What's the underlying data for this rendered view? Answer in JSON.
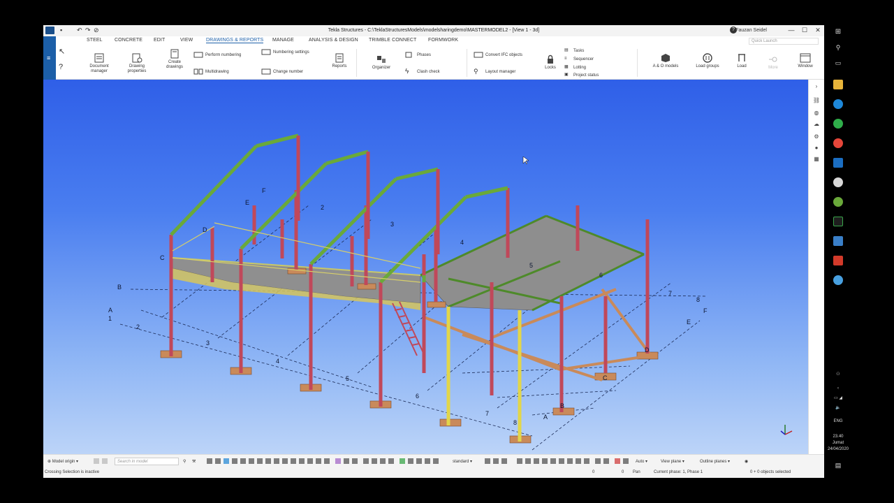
{
  "window": {
    "title": "Tekla Structures - C:\\TeklaStructuresModels\\modelsharingdemo\\MASTERMODEL2 - [View 1 - 3d]",
    "user": "Fauzan Seidel",
    "minimize": "—",
    "maximize": "☐",
    "close": "✕",
    "help": "?"
  },
  "tabs": [
    "STEEL",
    "CONCRETE",
    "EDIT",
    "VIEW",
    "DRAWINGS & REPORTS",
    "MANAGE",
    "ANALYSIS & DESIGN",
    "TRIMBLE CONNECT",
    "FORMWORK"
  ],
  "active_tab": "DRAWINGS & REPORTS",
  "quick_launch": "Quick Launch",
  "ribbon": {
    "document_manager": "Document manager",
    "drawing_properties": "Drawing properties",
    "create_drawings": "Create drawings",
    "perform_numbering": "Perform numbering",
    "numbering_settings": "Numbering settings",
    "multidrawing": "Multidrawing",
    "change_number": "Change number",
    "reports": "Reports",
    "organizer": "Organizer",
    "phases": "Phases",
    "clash_check": "Clash check",
    "convert_ifc": "Convert IFC objects",
    "layout_manager": "Layout manager",
    "locks": "Locks",
    "tasks": "Tasks",
    "sequencer": "Sequencer",
    "lotting": "Lotting",
    "project_status": "Project status",
    "ab_models": "A & O models",
    "load_groups": "Load groups",
    "load": "Load",
    "more": "More",
    "window": "Window"
  },
  "grid_labels": {
    "axis_numbers": [
      "1",
      "2",
      "3",
      "4",
      "5",
      "6",
      "7",
      "8"
    ],
    "axis_letters": [
      "A",
      "B",
      "C",
      "D",
      "E",
      "F"
    ],
    "floor_labels": [
      "5",
      "6"
    ]
  },
  "bottombar": {
    "model_origin": "Model origin",
    "search_placeholder": "Search in model",
    "standard": "standard",
    "auto": "Auto",
    "view_plane": "View plane",
    "outline_planes": "Outline planes"
  },
  "status": {
    "message": "Crossing Selection is inactive",
    "coord_x": "0",
    "coord_y": "0",
    "mode": "Pan",
    "phase": "Current phase: 1, Phase 1",
    "selection": "0 + 0 objects selected"
  },
  "taskbar": {
    "language": "ENG",
    "time": "23.40",
    "day": "Jumat",
    "date": "24/04/2020"
  },
  "colors": {
    "ribbon_accent": "#1c5fa8",
    "column": "#c0485a",
    "rafter": "#6aa93a",
    "yellow_column": "#e2d64a",
    "base_plate": "#c98a5a",
    "slab": "#9a9a9a"
  }
}
